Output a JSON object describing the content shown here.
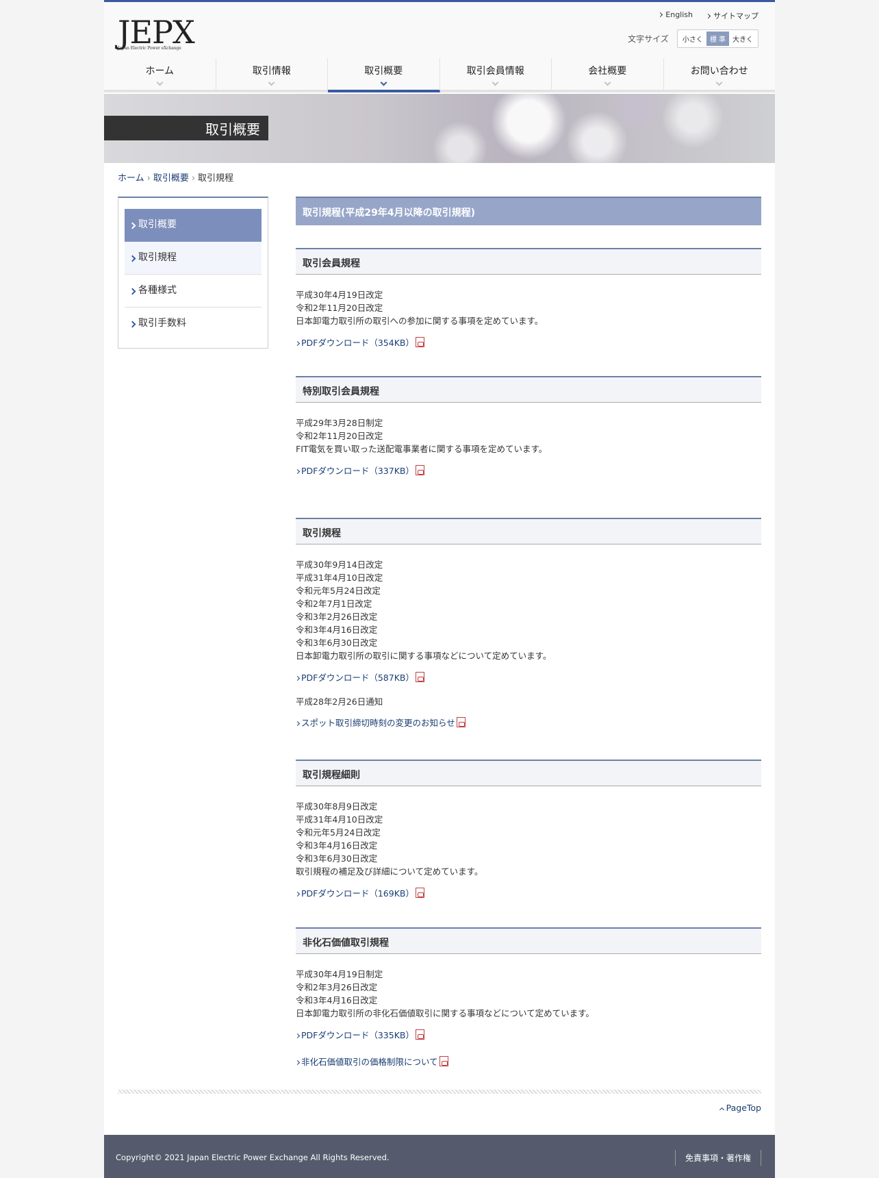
{
  "header": {
    "logo_text": "JEPX",
    "logo_sub": "Japan Electric Power eXchange",
    "english": "English",
    "sitemap": "サイトマップ",
    "fontsize_label": "文字サイズ",
    "fontsize_small": "小さく",
    "fontsize_std": "標 準",
    "fontsize_large": "大きく"
  },
  "gnav": [
    "ホーム",
    "取引情報",
    "取引概要",
    "取引会員情報",
    "会社概要",
    "お問い合わせ"
  ],
  "hero_title": "取引概要",
  "breadcrumb": [
    "ホーム",
    "取引概要",
    "取引規程"
  ],
  "breadcrumb_sep": "›",
  "side": [
    "取引概要",
    "取引規程",
    "各種様式",
    "取引手数料"
  ],
  "main_title": "取引規程(平成29年4月以降の取引規程)",
  "sections": [
    {
      "title": "取引会員規程",
      "lines": [
        "平成30年4月19日改定",
        "令和2年11月20日改定",
        "日本卸電力取引所の取引への参加に関する事項を定めています。"
      ],
      "links": [
        "PDFダウンロード（354KB）"
      ]
    },
    {
      "title": "特別取引会員規程",
      "lines": [
        "平成29年3月28日制定",
        "令和2年11月20日改定",
        "FIT電気を買い取った送配電事業者に関する事項を定めています。"
      ],
      "links": [
        "PDFダウンロード（337KB）"
      ]
    },
    {
      "title": "取引規程",
      "lines": [
        "平成30年9月14日改定",
        "平成31年4月10日改定",
        "令和元年5月24日改定",
        "令和2年7月1日改定",
        "令和3年2月26日改定",
        "令和3年4月16日改定",
        "令和3年6月30日改定",
        "日本卸電力取引所の取引に関する事項などについて定めています。"
      ],
      "links": [
        "PDFダウンロード（587KB）"
      ],
      "note": "平成28年2月26日通知",
      "note_link": "スポット取引締切時刻の変更のお知らせ"
    },
    {
      "title": "取引規程細則",
      "lines": [
        "平成30年8月9日改定",
        "平成31年4月10日改定",
        "令和元年5月24日改定",
        "令和3年4月16日改定",
        "令和3年6月30日改定",
        "取引規程の補足及び詳細について定めています。"
      ],
      "links": [
        "PDFダウンロード（169KB）"
      ]
    },
    {
      "title": "非化石価値取引規程",
      "lines": [
        "平成30年4月19日制定",
        "令和2年3月26日改定",
        "令和3年4月16日改定",
        "日本卸電力取引所の非化石価値取引に関する事項などについて定めています。"
      ],
      "links": [
        "PDFダウンロード（335KB）",
        "非化石価値取引の価格制限について"
      ]
    }
  ],
  "pagetop": "PageTop",
  "footer": {
    "copyright": "Copyright© 2021 Japan Electric Power Exchange All Rights Reserved.",
    "link": "免責事項・著作権"
  }
}
